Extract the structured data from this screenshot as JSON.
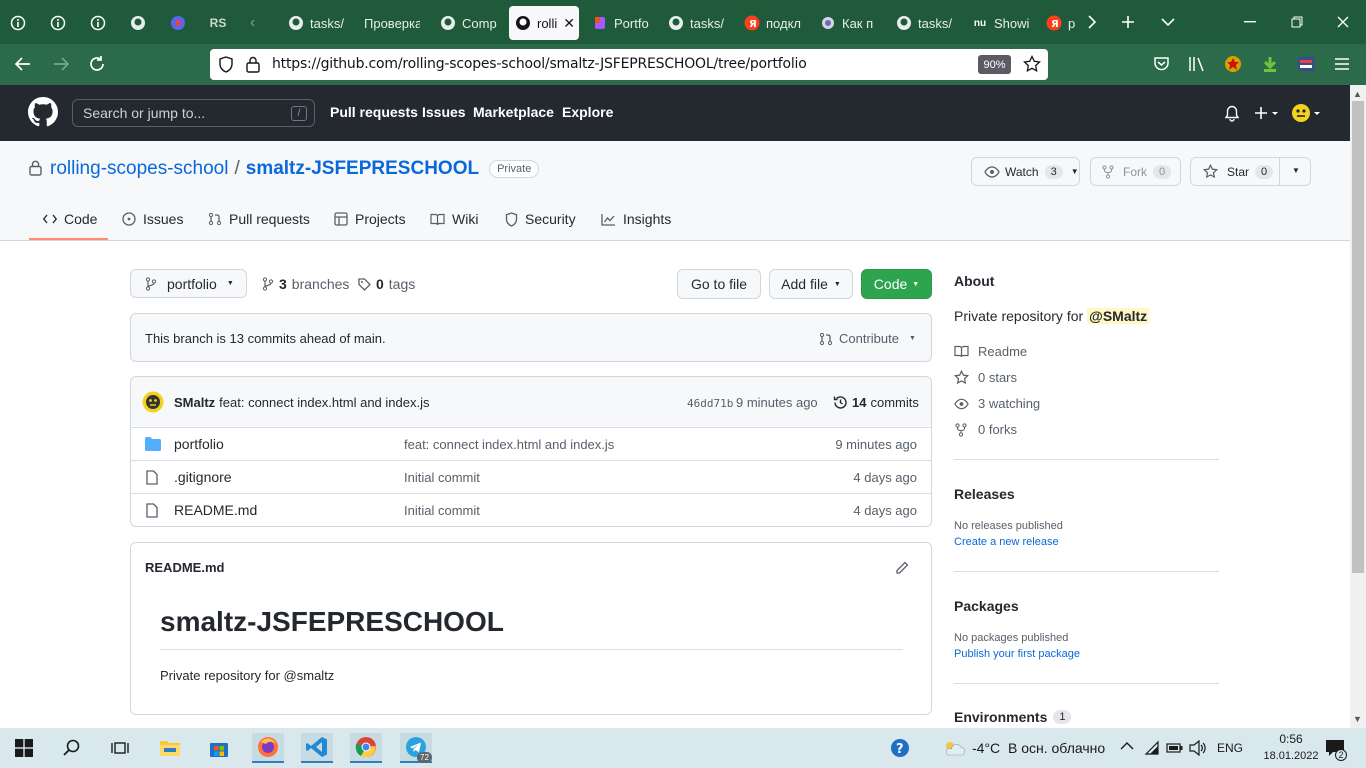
{
  "browser": {
    "tabs": [
      {
        "label": "",
        "icon": "info-icon"
      },
      {
        "label": "",
        "icon": "info-icon"
      },
      {
        "label": "",
        "icon": "info-icon"
      },
      {
        "label": "",
        "icon": "github-icon"
      },
      {
        "label": "",
        "icon": "discord-icon"
      },
      {
        "label": "",
        "icon": "rs-icon"
      },
      {
        "label": "tasks/",
        "icon": "github-icon"
      },
      {
        "label": "Проверка",
        "icon": ""
      },
      {
        "label": "Comp",
        "icon": "github-icon"
      },
      {
        "label": "rolli",
        "icon": "github-icon"
      },
      {
        "label": "Portfo",
        "icon": "figma-icon"
      },
      {
        "label": "tasks/",
        "icon": "github-icon"
      },
      {
        "label": "подкл",
        "icon": "yandex-icon"
      },
      {
        "label": "Как п",
        "icon": "globe-icon"
      },
      {
        "label": "tasks/",
        "icon": "github-icon"
      },
      {
        "label": "Showi",
        "icon": "nu-icon"
      },
      {
        "label": "р",
        "icon": "yandex-icon"
      }
    ],
    "url": "https://github.com/rolling-scopes-school/smaltz-JSFEPRESCHOOL/tree/portfolio",
    "zoom": "90%"
  },
  "gh_header": {
    "search_placeholder": "Search or jump to...",
    "slash": "/",
    "nav": [
      "Pull requests",
      "Issues",
      "Marketplace",
      "Explore"
    ]
  },
  "repo": {
    "owner": "rolling-scopes-school",
    "sep": "/",
    "name": "smaltz-JSFEPRESCHOOL",
    "visibility": "Private",
    "watch_label": "Watch",
    "watch_count": "3",
    "fork_label": "Fork",
    "fork_count": "0",
    "star_label": "Star",
    "star_count": "0",
    "tabs": [
      "Code",
      "Issues",
      "Pull requests",
      "Projects",
      "Wiki",
      "Security",
      "Insights"
    ]
  },
  "branchbar": {
    "branch": "portfolio",
    "branches_count": "3",
    "branches_label": "branches",
    "tags_count": "0",
    "tags_label": "tags",
    "go_to_file": "Go to file",
    "add_file": "Add file",
    "code": "Code"
  },
  "ahead": {
    "text": "This branch is 13 commits ahead of main.",
    "contribute": "Contribute"
  },
  "commit": {
    "author": "SMaltz",
    "message": "feat: connect index.html and index.js",
    "sha": "46dd71b",
    "time": "9 minutes ago",
    "commits_count": "14",
    "commits_label": "commits"
  },
  "files": [
    {
      "name": "portfolio",
      "type": "folder",
      "message": "feat: connect index.html and index.js",
      "time": "9 minutes ago"
    },
    {
      "name": ".gitignore",
      "type": "file",
      "message": "Initial commit",
      "time": "4 days ago"
    },
    {
      "name": "README.md",
      "type": "file",
      "message": "Initial commit",
      "time": "4 days ago"
    }
  ],
  "readme": {
    "filename": "README.md",
    "heading": "smaltz-JSFEPRESCHOOL",
    "body": "Private repository for @smaltz"
  },
  "sidebar": {
    "about_title": "About",
    "about_text": "Private repository for",
    "about_mention": "@SMaltz",
    "readme": "Readme",
    "stars": "0 stars",
    "watching": "3 watching",
    "forks": "0 forks",
    "releases_title": "Releases",
    "releases_none": "No releases published",
    "releases_link": "Create a new release",
    "packages_title": "Packages",
    "packages_none": "No packages published",
    "packages_link": "Publish your first package",
    "env_title": "Environments",
    "env_count": "1"
  },
  "taskbar": {
    "telegram_badge": "72",
    "temp": "-4°C",
    "weather": "В осн. облачно",
    "lang": "ENG",
    "time": "0:56",
    "date": "18.01.2022",
    "notif_count": "2"
  },
  "colors": {
    "firefox_green": "#1f5a3a",
    "github_dark": "#24292f",
    "primary_green": "#2da44e",
    "link_blue": "#0969da",
    "tab_underline": "#fd8c73"
  }
}
